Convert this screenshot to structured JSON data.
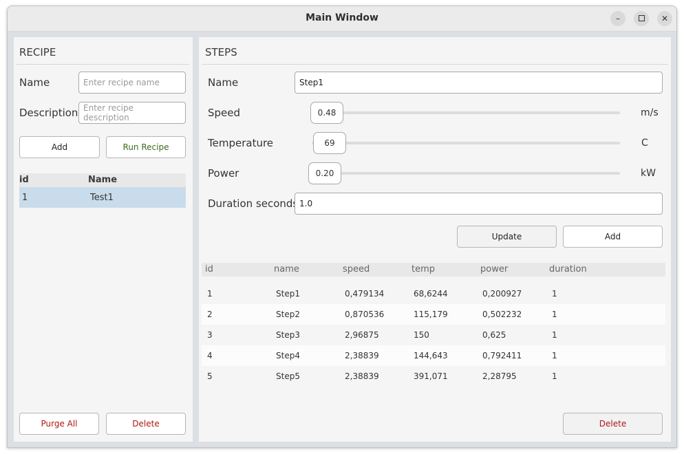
{
  "window": {
    "title": "Main Window"
  },
  "recipe": {
    "title": "RECIPE",
    "name_label": "Name",
    "name_placeholder": "Enter recipe name",
    "description_label": "Description",
    "description_placeholder": "Enter recipe description",
    "add_label": "Add",
    "run_label": "Run Recipe",
    "columns": [
      "id",
      "Name"
    ],
    "rows": [
      {
        "id": "1",
        "name": "Test1",
        "selected": true
      }
    ],
    "purge_label": "Purge All",
    "delete_label": "Delete"
  },
  "steps": {
    "title": "STEPS",
    "name_label": "Name",
    "name_value": "Step1",
    "speed": {
      "label": "Speed",
      "value": "0.48",
      "unit": "m/s"
    },
    "temperature": {
      "label": "Temperature",
      "value": "69",
      "unit": "C"
    },
    "power": {
      "label": "Power",
      "value": "0.20",
      "unit": "kW"
    },
    "duration_label": "Duration seconds",
    "duration_value": "1.0",
    "update_label": "Update",
    "add_label": "Add",
    "columns": [
      "id",
      "name",
      "speed",
      "temp",
      "power",
      "duration"
    ],
    "rows": [
      {
        "id": "1",
        "name": "Step1",
        "speed": "0,479134",
        "temp": "68,6244",
        "power": "0,200927",
        "duration": "1"
      },
      {
        "id": "2",
        "name": "Step2",
        "speed": "0,870536",
        "temp": "115,179",
        "power": "0,502232",
        "duration": "1"
      },
      {
        "id": "3",
        "name": "Step3",
        "speed": "2,96875",
        "temp": "150",
        "power": "0,625",
        "duration": "1"
      },
      {
        "id": "4",
        "name": "Step4",
        "speed": "2,38839",
        "temp": "144,643",
        "power": "0,792411",
        "duration": "1"
      },
      {
        "id": "5",
        "name": "Step5",
        "speed": "2,38839",
        "temp": "391,071",
        "power": "2,28795",
        "duration": "1"
      }
    ],
    "delete_label": "Delete"
  },
  "icons": {
    "minimize": "minimize-icon",
    "maximize": "maximize-icon",
    "close": "close-icon"
  },
  "colors": {
    "selection": "#c9dcec",
    "delete_text": "#b01515",
    "run_text": "#3a6b1e"
  }
}
